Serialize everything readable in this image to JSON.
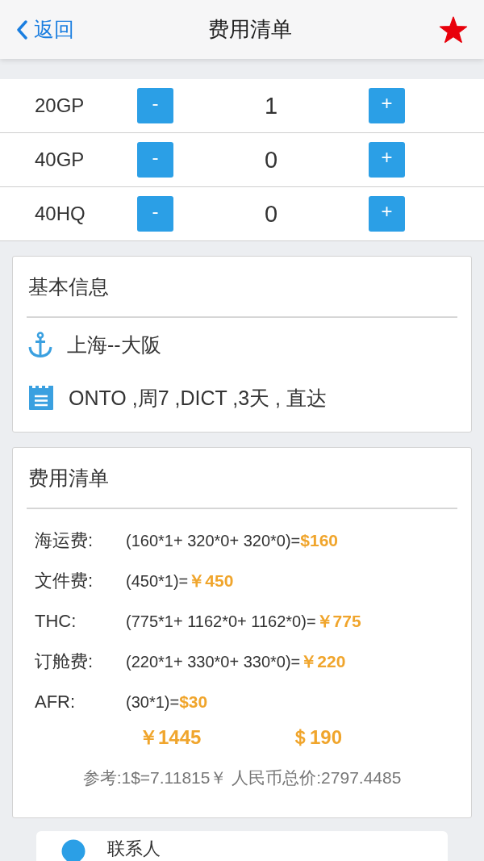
{
  "header": {
    "back": "返回",
    "title": "费用清单",
    "favorite": true
  },
  "containers": [
    {
      "type": "20GP",
      "minus": "-",
      "count": "1",
      "plus": "+"
    },
    {
      "type": "40GP",
      "minus": "-",
      "count": "0",
      "plus": "+"
    },
    {
      "type": "40HQ",
      "minus": "-",
      "count": "0",
      "plus": "+"
    }
  ],
  "basic_info": {
    "title": "基本信息",
    "items": [
      {
        "kind": "route",
        "text": "上海--大阪"
      },
      {
        "kind": "schedule",
        "text": "ONTO ,周7 ,DICT ,3天 , 直达"
      }
    ]
  },
  "fees": {
    "title": "费用清单",
    "items": [
      {
        "label": "海运费:",
        "formula": "(160*1+ 320*0+ 320*0)=",
        "amount": "$160"
      },
      {
        "label": "文件费:",
        "formula": "(450*1)=",
        "amount": "￥450"
      },
      {
        "label": "THC:",
        "formula": "(775*1+ 1162*0+ 1162*0)=",
        "amount": "￥775"
      },
      {
        "label": "订舱费:",
        "formula": "(220*1+ 330*0+ 330*0)=",
        "amount": "￥220"
      },
      {
        "label": "AFR:",
        "formula": "(30*1)=",
        "amount": "$30"
      }
    ],
    "totals": [
      "￥1445",
      "＄190"
    ],
    "note": "参考:1$=7.11815￥ 人民币总价:2797.4485"
  },
  "contact": {
    "label": "联系人"
  }
}
